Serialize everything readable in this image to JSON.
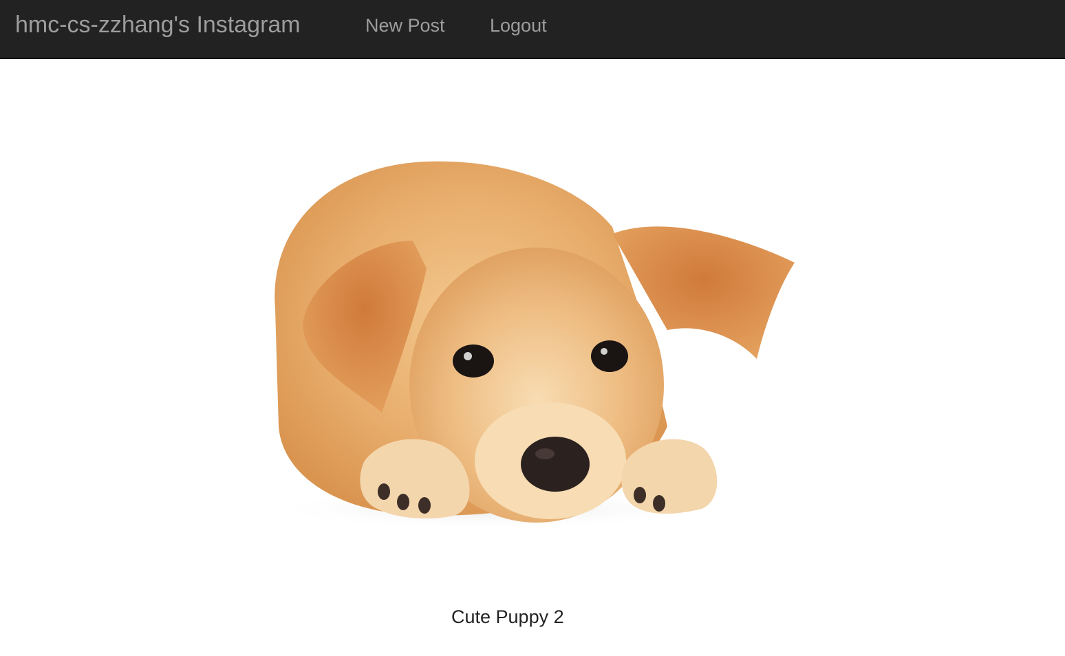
{
  "navbar": {
    "brand": "hmc-cs-zzhang's Instagram",
    "links": [
      {
        "label": "New Post"
      },
      {
        "label": "Logout"
      }
    ]
  },
  "post": {
    "caption": "Cute Puppy 2"
  },
  "colors": {
    "navbar_bg": "#222222",
    "nav_text": "#9d9d9d",
    "fur": "#e9b070",
    "fur_dark": "#d98d4a",
    "fur_light": "#f7dcb4"
  }
}
